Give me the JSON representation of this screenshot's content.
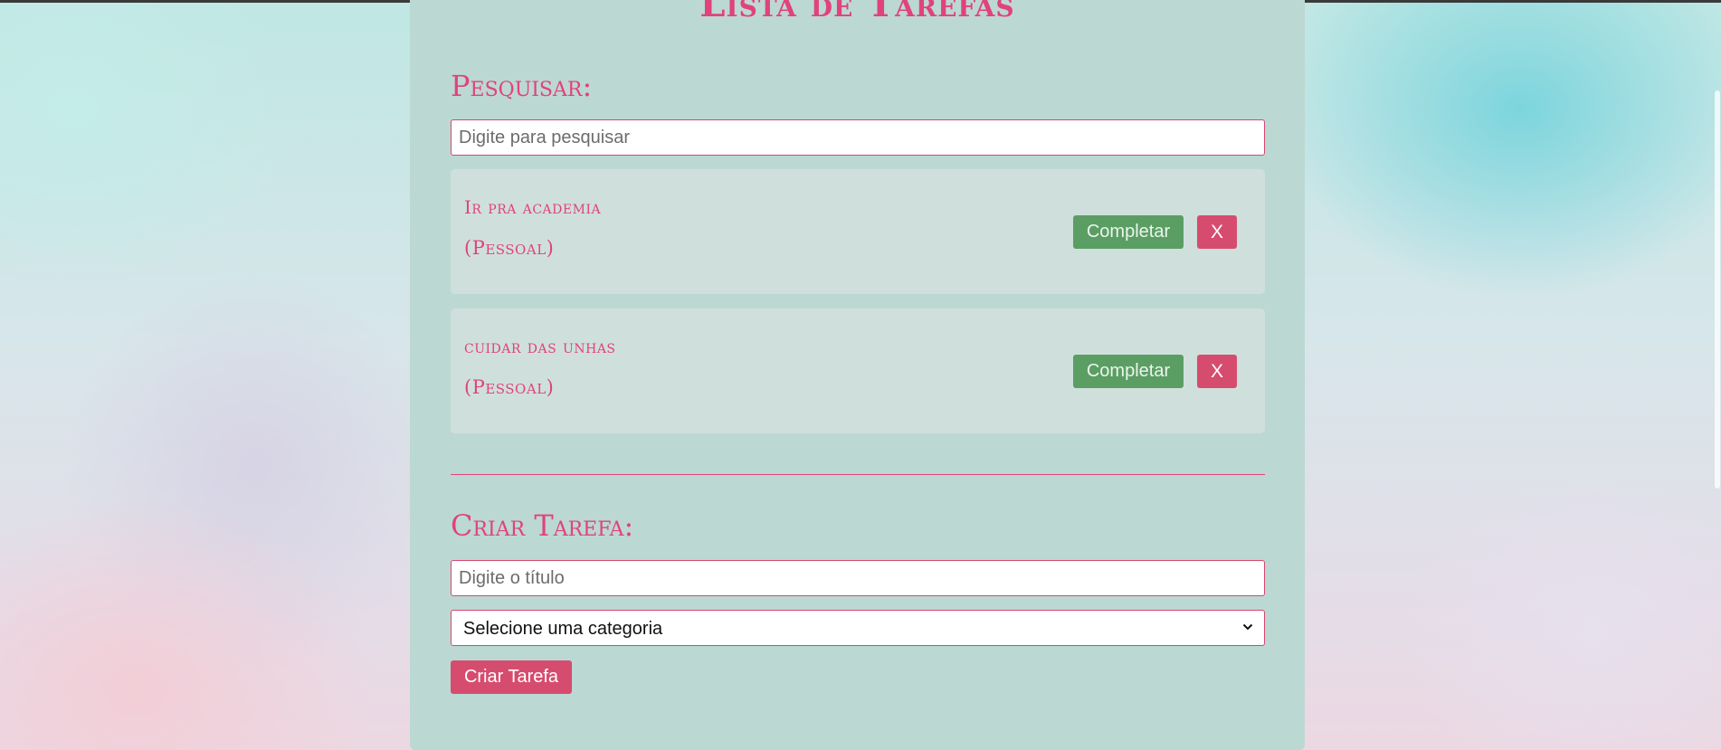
{
  "page": {
    "title": "Lista de Tarefas"
  },
  "search": {
    "heading": "Pesquisar:",
    "placeholder": "Digite para pesquisar",
    "value": ""
  },
  "tasks": [
    {
      "title": "Ir pra academia",
      "category": "(Pessoal)",
      "complete_label": "Completar",
      "remove_label": "X"
    },
    {
      "title": "cuidar das unhas",
      "category": "(Pessoal)",
      "complete_label": "Completar",
      "remove_label": "X"
    }
  ],
  "create": {
    "heading": "Criar Tarefa:",
    "title_placeholder": "Digite o título",
    "title_value": "",
    "category_selected": "Selecione uma categoria",
    "submit_label": "Criar Tarefa"
  },
  "colors": {
    "accent": "#e0437a",
    "complete_button": "#5b9e63",
    "remove_button": "#d64c6e",
    "panel": "#bcd8d3",
    "task_card": "#cfe0dc"
  },
  "icons": {
    "select_arrow": "chevron-down-icon"
  }
}
